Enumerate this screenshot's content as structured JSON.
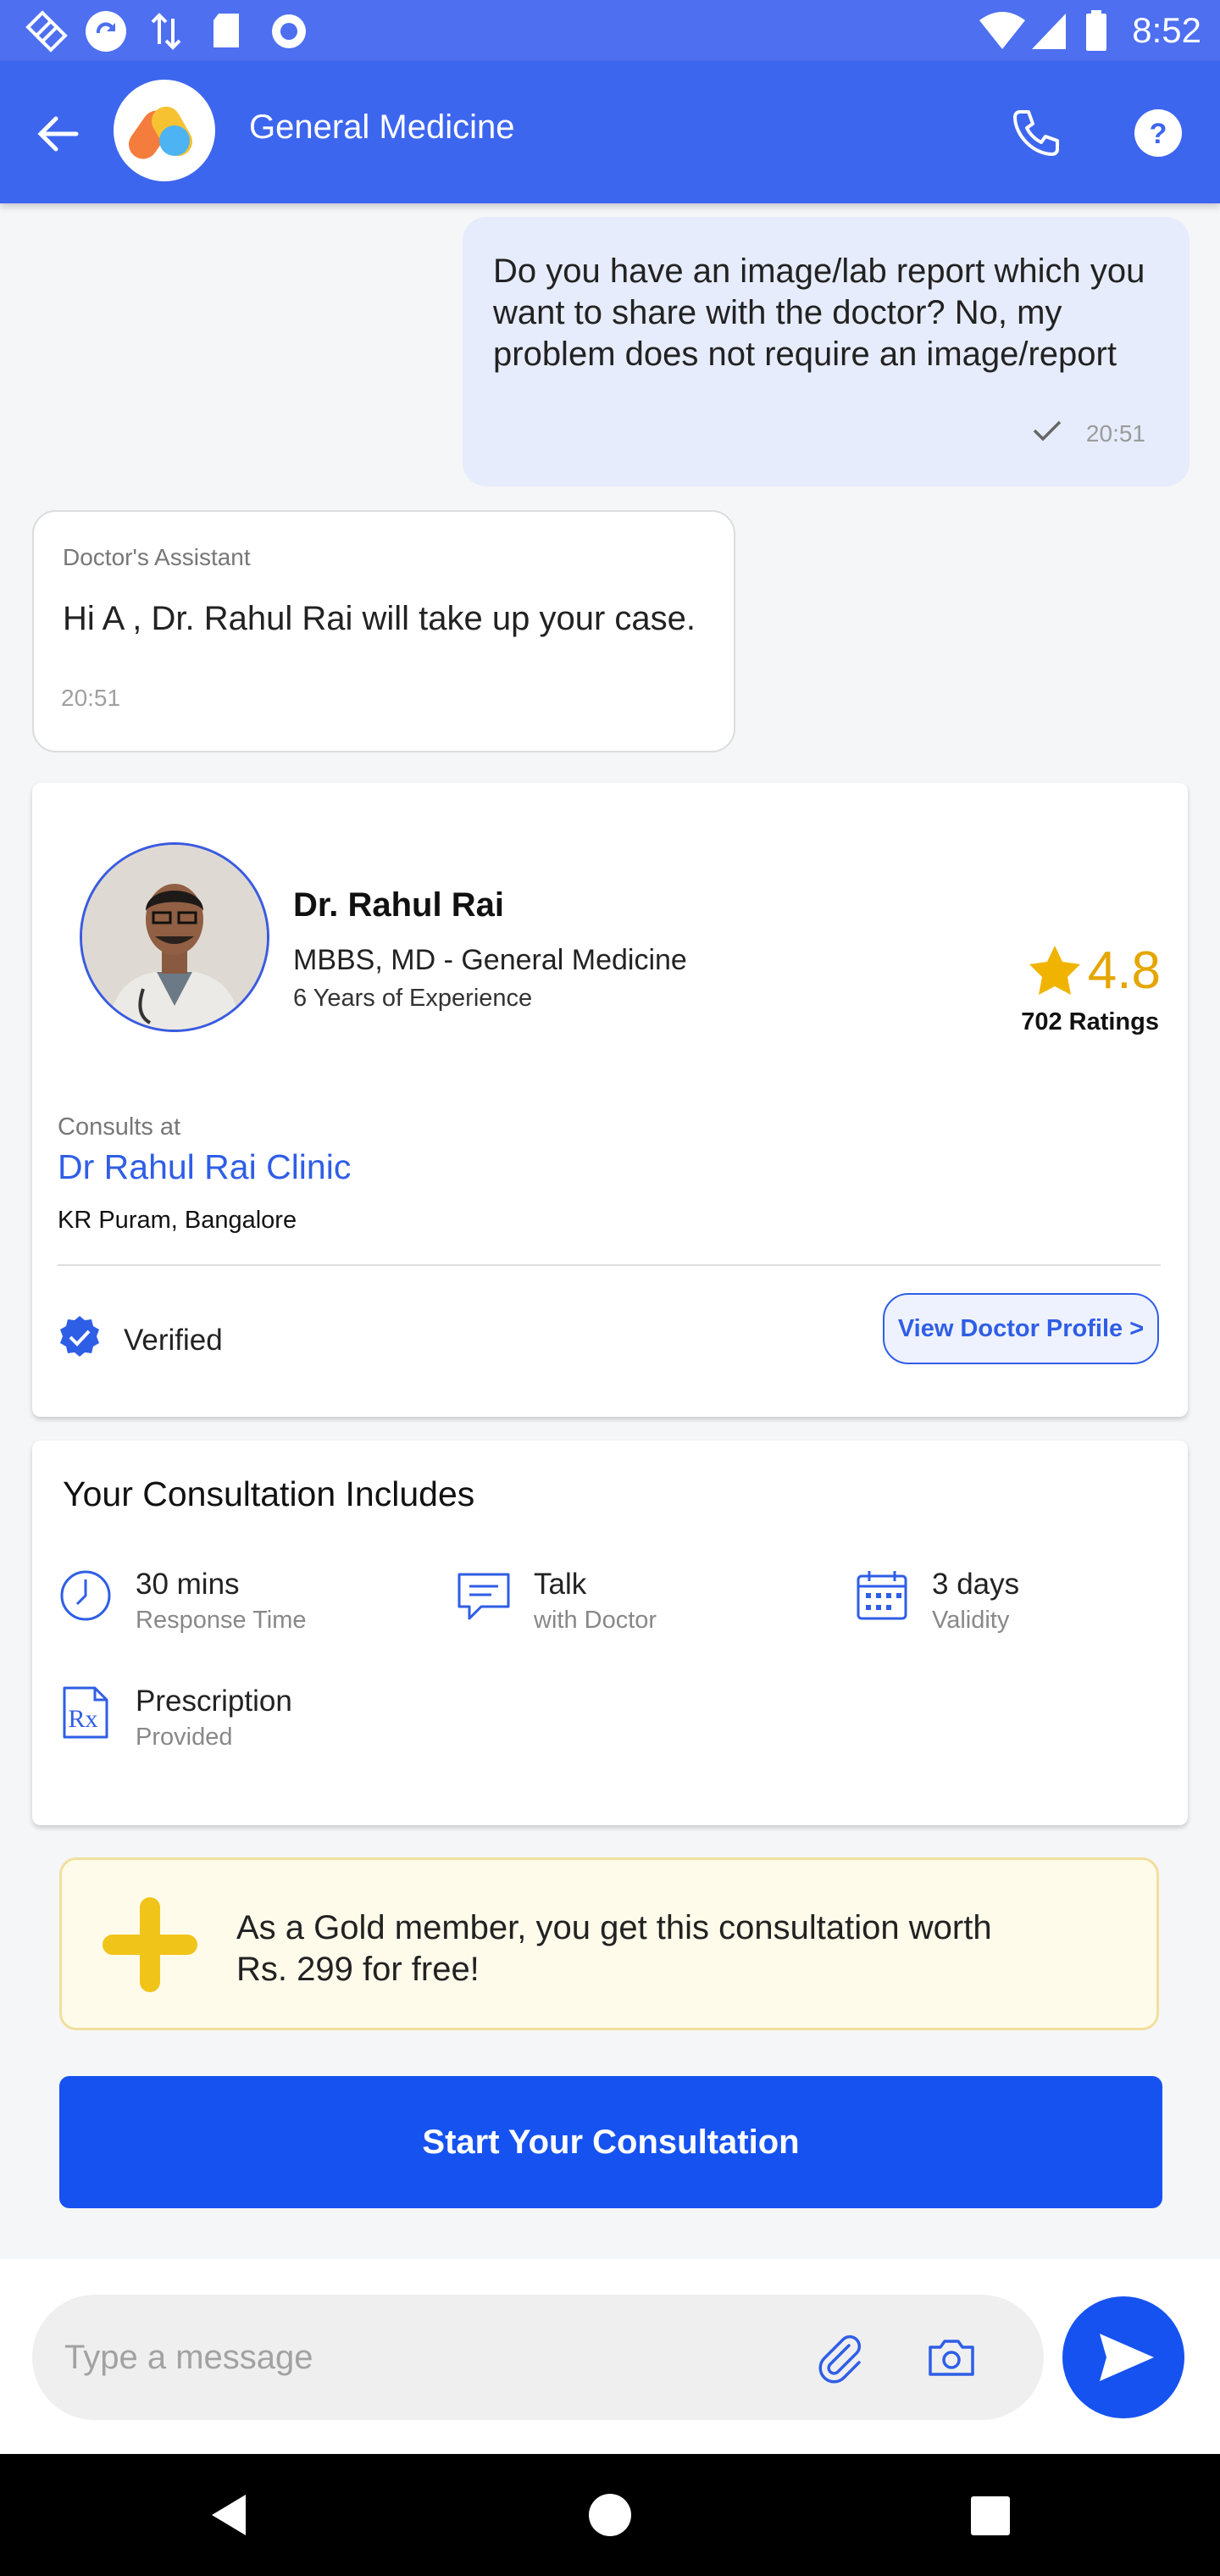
{
  "status_bar": {
    "time": "8:52"
  },
  "header": {
    "title": "General Medicine"
  },
  "colors": {
    "primary": "#3d66ef",
    "accent_blue": "#1652f0",
    "rating": "#e5a600",
    "gold": "#f0c419"
  },
  "chat": {
    "user_message": "Do you have an image/lab report which you want to share with the doctor? No, my problem does not require an image/report",
    "user_time": "20:51",
    "assistant_sender": "Doctor's Assistant",
    "assistant_message": "Hi A , Dr. Rahul Rai will take up your case.",
    "assistant_time": "20:51"
  },
  "doctor": {
    "name": "Dr. Rahul Rai",
    "degree": "MBBS, MD - General Medicine",
    "experience": "6 Years of Experience",
    "rating": "4.8",
    "ratings_count": "702 Ratings",
    "consults_label": "Consults at",
    "clinic": "Dr Rahul Rai Clinic",
    "location": "KR Puram, Bangalore",
    "verified": "Verified",
    "profile_button": "View Doctor Profile >"
  },
  "consultation": {
    "title": "Your Consultation Includes",
    "features": [
      {
        "icon": "clock-icon",
        "main": "30 mins",
        "sub": "Response Time"
      },
      {
        "icon": "chat-icon",
        "main": "Talk",
        "sub": "with Doctor"
      },
      {
        "icon": "calendar-icon",
        "main": "3 days",
        "sub": "Validity"
      },
      {
        "icon": "prescription-icon",
        "main": "Prescription",
        "sub": "Provided"
      }
    ]
  },
  "gold_banner": {
    "text": "As a Gold member, you get this consultation worth Rs. 299 for free!"
  },
  "start_button": "Start Your Consultation",
  "composer": {
    "placeholder": "Type a message"
  }
}
